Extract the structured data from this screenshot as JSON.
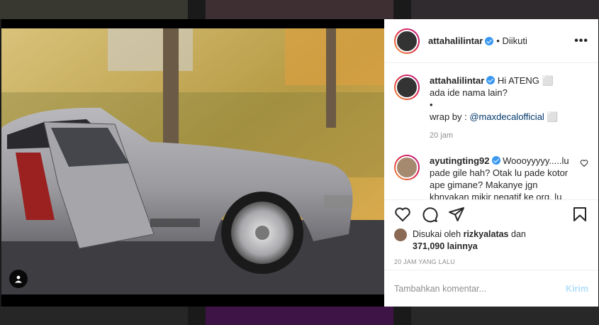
{
  "post": {
    "author": "attahalilintar",
    "follow_status": "• Diikuti",
    "more_icon": "•••"
  },
  "caption": {
    "username": "attahalilintar",
    "text": "Hi ATENG ⬜",
    "line2": "ada ide nama lain?",
    "line3": "•",
    "wrap_prefix": "wrap by : ",
    "wrap_mention": "@maxdecalofficial",
    "wrap_suffix": " ⬜",
    "time": "20 jam"
  },
  "comment": {
    "username": "ayutingting92",
    "text": "Woooyyyyy.....lu pade gile hah? Otak lu pade kotor ape gimane? Makanye jgn kbnyakan mikir negatif ke org. lu"
  },
  "likes": {
    "prefix": "Disukai oleh ",
    "user": "rizkyalatas",
    "suffix": " dan",
    "count_text": "371,090 lainnya"
  },
  "timestamp": "20 JAM YANG LALU",
  "add_comment": {
    "placeholder": "Tambahkan komentar...",
    "post_label": "Kirim"
  },
  "colors": {
    "verified": "#3897f0",
    "link": "#00376b",
    "post_disabled": "#b2dffc"
  }
}
